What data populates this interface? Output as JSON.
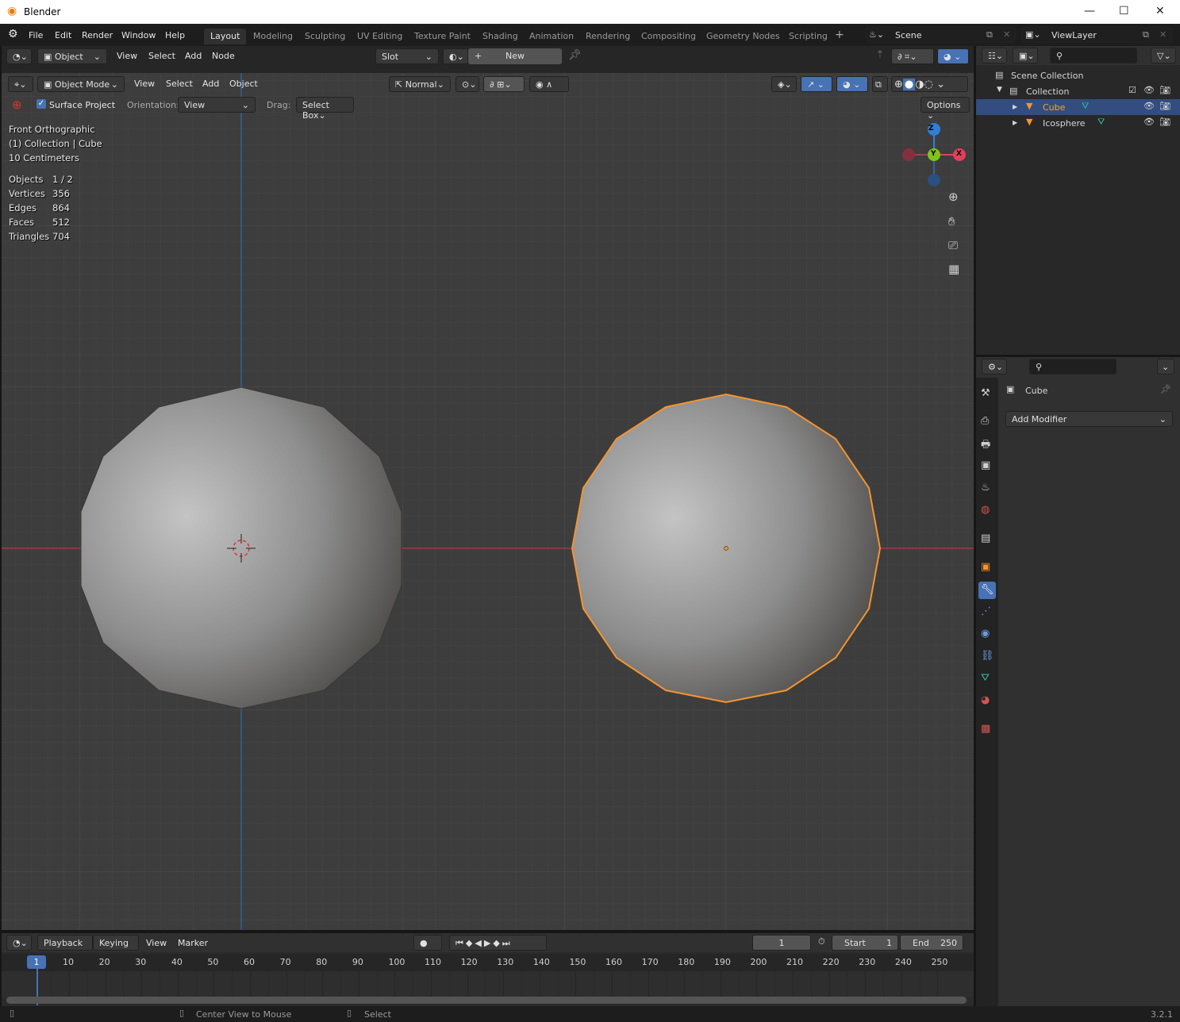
{
  "window": {
    "title": "Blender",
    "controls": [
      "—",
      "☐",
      "✕"
    ]
  },
  "menubar": {
    "items": [
      "File",
      "Edit",
      "Render",
      "Window",
      "Help"
    ],
    "workspaces": [
      "Layout",
      "Modeling",
      "Sculpting",
      "UV Editing",
      "Texture Paint",
      "Shading",
      "Animation",
      "Rendering",
      "Compositing",
      "Geometry Nodes",
      "Scripting"
    ],
    "active_workspace": "Layout",
    "add_tab": "+",
    "scene": "Scene",
    "view_layer": "ViewLayer"
  },
  "shader_header": {
    "mode": "Object",
    "menus": [
      "View",
      "Select",
      "Add",
      "Node"
    ],
    "slot": "Slot",
    "new_label": "New",
    "new_plus": "+"
  },
  "viewport_header": {
    "mode": "Object Mode",
    "menus": [
      "View",
      "Select",
      "Add",
      "Object"
    ],
    "orientation_pivot": "Normal"
  },
  "tool_options": {
    "surface_project_label": "Surface Project",
    "surface_project_checked": true,
    "orientation_label": "Orientation:",
    "orientation_value": "View",
    "drag_label": "Drag:",
    "drag_value": "Select Box",
    "options_label": "Options"
  },
  "overlay": {
    "view_name": "Front Orthographic",
    "context": "(1) Collection | Cube",
    "scale": "10 Centimeters",
    "stats": [
      {
        "label": "Objects",
        "value": "1 / 2"
      },
      {
        "label": "Vertices",
        "value": "356"
      },
      {
        "label": "Edges",
        "value": "864"
      },
      {
        "label": "Faces",
        "value": "512"
      },
      {
        "label": "Triangles",
        "value": "704"
      }
    ]
  },
  "gizmo": {
    "z": "Z",
    "y": "Y",
    "x": "X",
    "colors": {
      "x": "#e0415a",
      "y": "#7fc31b",
      "z": "#2f7fd8"
    }
  },
  "outliner": {
    "scene_collection": "Scene Collection",
    "collection": "Collection",
    "objects": [
      {
        "name": "Cube",
        "selected": true
      },
      {
        "name": "Icosphere",
        "selected": false
      }
    ]
  },
  "properties": {
    "object_name": "Cube",
    "add_modifier": "Add Modifier"
  },
  "timeline": {
    "menus": [
      "Playback",
      "Keying",
      "View",
      "Marker"
    ],
    "current_frame": "1",
    "start_label": "Start",
    "start": "1",
    "end_label": "End",
    "end": "250",
    "ticks": [
      "10",
      "20",
      "30",
      "40",
      "50",
      "60",
      "70",
      "80",
      "90",
      "100",
      "110",
      "120",
      "130",
      "140",
      "150",
      "160",
      "170",
      "180",
      "190",
      "200",
      "210",
      "220",
      "230",
      "240",
      "250"
    ]
  },
  "statusbar": {
    "middle": "Center View to Mouse",
    "right": "Select",
    "version": "3.2.1"
  },
  "colors": {
    "accent": "#4772b3",
    "selection": "#f5942f",
    "x_axis": "#b0384e",
    "z_axis": "#2f68b0"
  }
}
